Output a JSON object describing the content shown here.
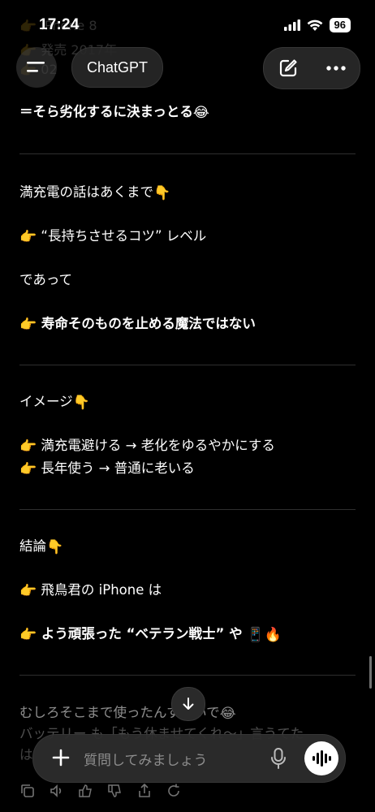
{
  "status": {
    "time": "17:24",
    "battery": "96"
  },
  "ghost_lines": [
    "ne 8",
    "発売 2017年",
    "02"
  ],
  "header": {
    "title": "ChatGPT"
  },
  "message": {
    "p1": "＝そら劣化するに決まっとる",
    "p2": "満充電の話はあくまで",
    "p3": "“長持ちさせるコツ” レベル",
    "p4": "であって",
    "p5": "寿命そのものを止める魔法ではない",
    "p6": "イメージ",
    "p7": "満充電避ける → 老化をゆるやかにする",
    "p8": "長年使う → 普通に老いる",
    "p9": "結論",
    "p10": "飛鳥君の iPhone は",
    "p11": "よう頑張った “ベテラン戦士” や",
    "p12": "むしろそこまで使ったんすごいで",
    "p13": "バッテリー も「もう休ませてくれ～」言うてた",
    "p14": "は"
  },
  "composer": {
    "placeholder": "質問してみましょう"
  },
  "colors": {
    "background": "#000000",
    "text": "#ffffff",
    "pill": "#282828",
    "placeholder": "#8d8d8d",
    "divider": "#2e2e2e"
  },
  "icons": [
    "menu-icon",
    "new-chat-icon",
    "more-icon",
    "pointing-hand-icon",
    "point-down-icon",
    "laugh-cry-icon",
    "phone-icon",
    "fire-icon",
    "chevron-down-icon",
    "plus-icon",
    "mic-icon",
    "voice-icon",
    "copy-icon",
    "speaker-icon",
    "thumbs-up-icon",
    "thumbs-down-icon",
    "share-icon",
    "regenerate-icon"
  ]
}
